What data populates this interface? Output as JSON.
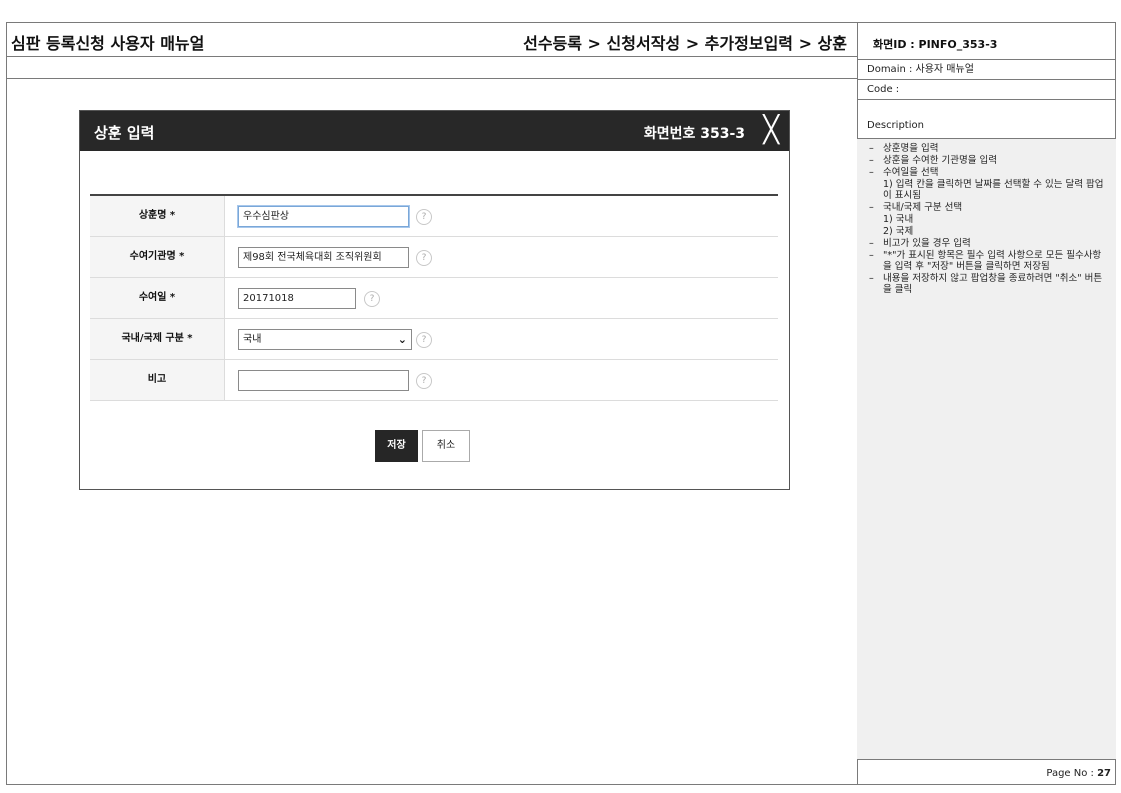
{
  "header": {
    "doc_title": "심판 등록신청 사용자 매뉴얼",
    "breadcrumb": "선수등록 > 신청서작성 > 추가정보입력 > 상훈"
  },
  "side": {
    "screen_id": "화면ID : PINFO_353-3",
    "domain": "Domain : 사용자 매뉴얼",
    "code": "Code :",
    "description_label": "Description",
    "description_items": [
      "상훈명을 입력",
      "상훈을 수여한 기관명을 입력",
      "수여일을 선택",
      "1) 입력 칸을 클릭하면 날짜를 선택할 수 있는 달력 팝업이 표시됨",
      "국내/국제 구분 선택",
      "1) 국내",
      "2) 국제",
      "비고가 있을 경우 입력",
      "\"*\"가 표시된 항목은 필수 입력 사항으로 모든 필수사항을 입력 후 \"저장\" 버튼을 클릭하면 저장됨",
      "내용을 저장하지 않고 팝업창을 종료하려면 \"취소\" 버튼을 클릭"
    ],
    "page_label": "Page No : ",
    "page_number": "27"
  },
  "modal": {
    "title": "상훈 입력",
    "screen_number": "화면번호 353-3",
    "close_glyph": "╳",
    "fields": [
      {
        "label": "상훈명 *",
        "value": "우수심판상"
      },
      {
        "label": "수여기관명 *",
        "value": "제98회 전국체육대회 조직위원회"
      },
      {
        "label": "수여일 *",
        "value": "20171018"
      },
      {
        "label": "국내/국제 구분 *",
        "value": "국내"
      },
      {
        "label": "비고",
        "value": ""
      }
    ],
    "help_glyph": "?",
    "save_label": "저장",
    "cancel_label": "취소",
    "chevron_glyph": "⌄"
  }
}
